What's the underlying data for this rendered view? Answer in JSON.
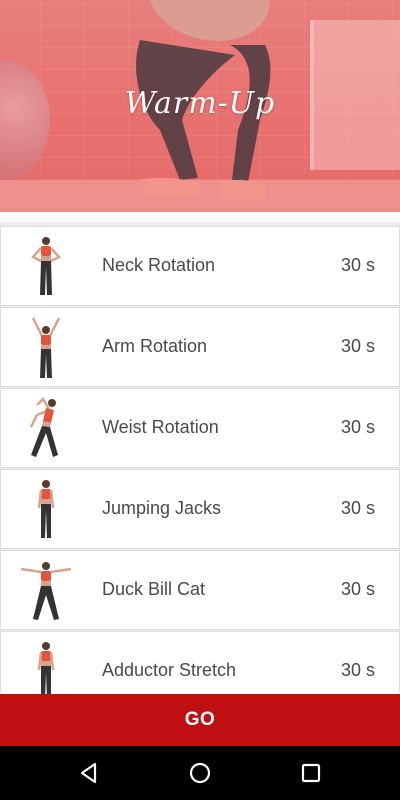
{
  "header": {
    "title": "Warm-Up"
  },
  "exercises": [
    {
      "name": "Neck Rotation",
      "duration": "30 s",
      "icon": "figure-hands-on-hips-icon"
    },
    {
      "name": "Arm Rotation",
      "duration": "30 s",
      "icon": "figure-arms-raised-icon"
    },
    {
      "name": "Weist Rotation",
      "duration": "30 s",
      "icon": "figure-side-bend-icon"
    },
    {
      "name": "Jumping Jacks",
      "duration": "30 s",
      "icon": "figure-standing-icon"
    },
    {
      "name": "Duck Bill Cat",
      "duration": "30 s",
      "icon": "figure-arms-spread-icon"
    },
    {
      "name": "Adductor Stretch",
      "duration": "30 s",
      "icon": "figure-standing-icon"
    }
  ],
  "go_button": {
    "label": "GO"
  },
  "navbar": {
    "back": "back-triangle-icon",
    "home": "home-circle-icon",
    "recents": "recents-square-icon"
  },
  "colors": {
    "hero_tint": "#e8716f",
    "go_button": "#c00f13",
    "figure_top": "#e0553c",
    "figure_pants": "#333333",
    "text": "#4a4a4a"
  }
}
